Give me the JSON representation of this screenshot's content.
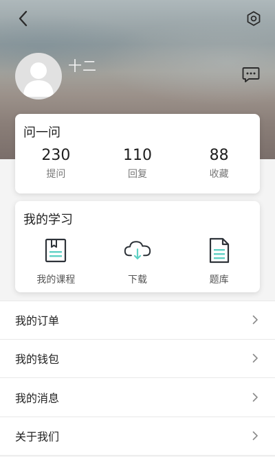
{
  "header": {
    "username": "十二",
    "back_icon": "chevron-left-icon",
    "settings_icon": "settings-icon",
    "message_icon": "chat-bubble-icon"
  },
  "ask_card": {
    "title": "问一问",
    "stats": [
      {
        "value": "230",
        "label": "提问"
      },
      {
        "value": "110",
        "label": "回复"
      },
      {
        "value": "88",
        "label": "收藏"
      }
    ]
  },
  "study_card": {
    "title": "我的学习",
    "items": [
      {
        "label": "我的课程",
        "icon": "course-book-icon"
      },
      {
        "label": "下载",
        "icon": "cloud-download-icon"
      },
      {
        "label": "题库",
        "icon": "question-bank-icon"
      }
    ]
  },
  "menu": {
    "items": [
      {
        "label": "我的订单"
      },
      {
        "label": "我的钱包"
      },
      {
        "label": "我的消息"
      },
      {
        "label": "关于我们"
      }
    ]
  },
  "colors": {
    "accent": "#5ed1c4",
    "icon_dark": "#2d3238",
    "card_bg": "#ffffff",
    "page_bg": "#f4f4f4"
  }
}
